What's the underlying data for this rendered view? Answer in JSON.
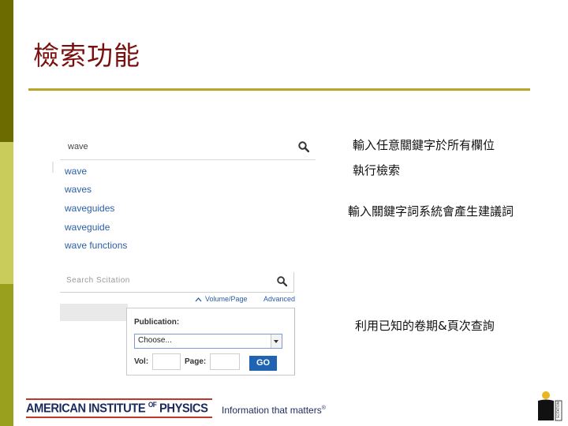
{
  "slide": {
    "title": "檢索功能"
  },
  "search_autocomplete": {
    "query": "wave",
    "suggestions": [
      "wave",
      "waves",
      "waveguides",
      "waveguide",
      "wave functions"
    ]
  },
  "citation_search": {
    "placeholder": "Search Scitation",
    "volume_page_link": "Volume/Page",
    "advanced_link": "Advanced",
    "publication_label": "Publication:",
    "publication_value": "Choose...",
    "vol_label": "Vol:",
    "page_label": "Page:",
    "go_label": "GO"
  },
  "annotations": {
    "note1": "輸入任意關鍵字於所有欄位",
    "note2": "執行檢索",
    "note3": "輸入關鍵字詞系統會產生建議詞",
    "note4": "利用已知的卷期&頁次查詢"
  },
  "footer": {
    "aip_name_part1": "AMERICAN INSTITUTE",
    "aip_of": "OF",
    "aip_name_part2": "PHYSICS",
    "tagline": "Information that matters",
    "registered": "®",
    "logo_letter": "i",
    "logo_text": "SCITATION"
  },
  "colors": {
    "title": "#7a0f0f",
    "rule": "#b9a52a",
    "link": "#2a5ea6",
    "go_button": "#1f63b3",
    "aip_navy": "#1d2a5c",
    "aip_red": "#c1372a"
  }
}
